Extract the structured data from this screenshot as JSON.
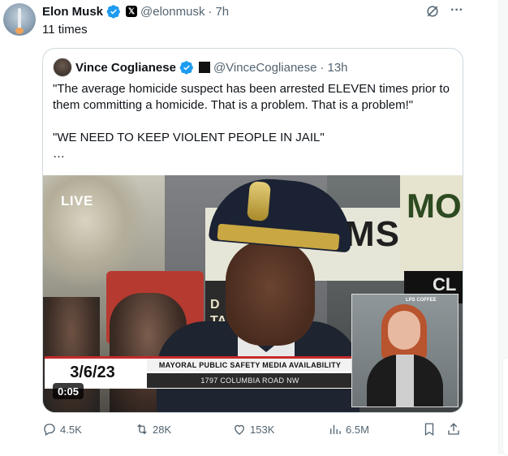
{
  "post": {
    "author_name": "Elon Musk",
    "author_handle": "@elonmusk",
    "separator": "·",
    "time": "7h",
    "text": "11 times"
  },
  "quote": {
    "author_name": "Vince Coglianese",
    "author_handle": "@VinceCoglianese",
    "separator": "·",
    "time": "13h",
    "text": "\"The average homicide suspect has been arrested ELEVEN times prior to them committing a homicide. That is a problem. That is a problem!\"\n\n\"WE NEED TO KEEP VIOLENT PEOPLE IN JAIL\"\n…"
  },
  "video": {
    "live_label": "LIVE",
    "date": "3/6/23",
    "caption_top": "MAYORAL PUBLIC SAFETY MEDIA AVAILABILITY",
    "caption_bottom": "1797 COLUMBIA ROAD NW",
    "duration": "0:05",
    "background_sign_text": "ADAMS",
    "background_sign2_text": "MOR",
    "background_sign3_text": "CL",
    "background_sign4_text": "D\nTA",
    "interpreter_sign_text": "LPS COFFEE"
  },
  "actions": {
    "replies": "4.5K",
    "reposts": "28K",
    "likes": "153K",
    "views": "6.5M"
  },
  "icons": {
    "verified": "verified-badge-icon",
    "affiliation": "x-affiliation-icon",
    "grok": "grok-icon",
    "more": "more-icon",
    "reply": "reply-icon",
    "repost": "repost-icon",
    "like": "like-icon",
    "views": "views-icon",
    "bookmark": "bookmark-icon",
    "share": "share-icon"
  },
  "colors": {
    "verified_blue": "#1d9bf0",
    "text_primary": "#0f1419",
    "text_secondary": "#536471",
    "border": "#cfd9de"
  }
}
